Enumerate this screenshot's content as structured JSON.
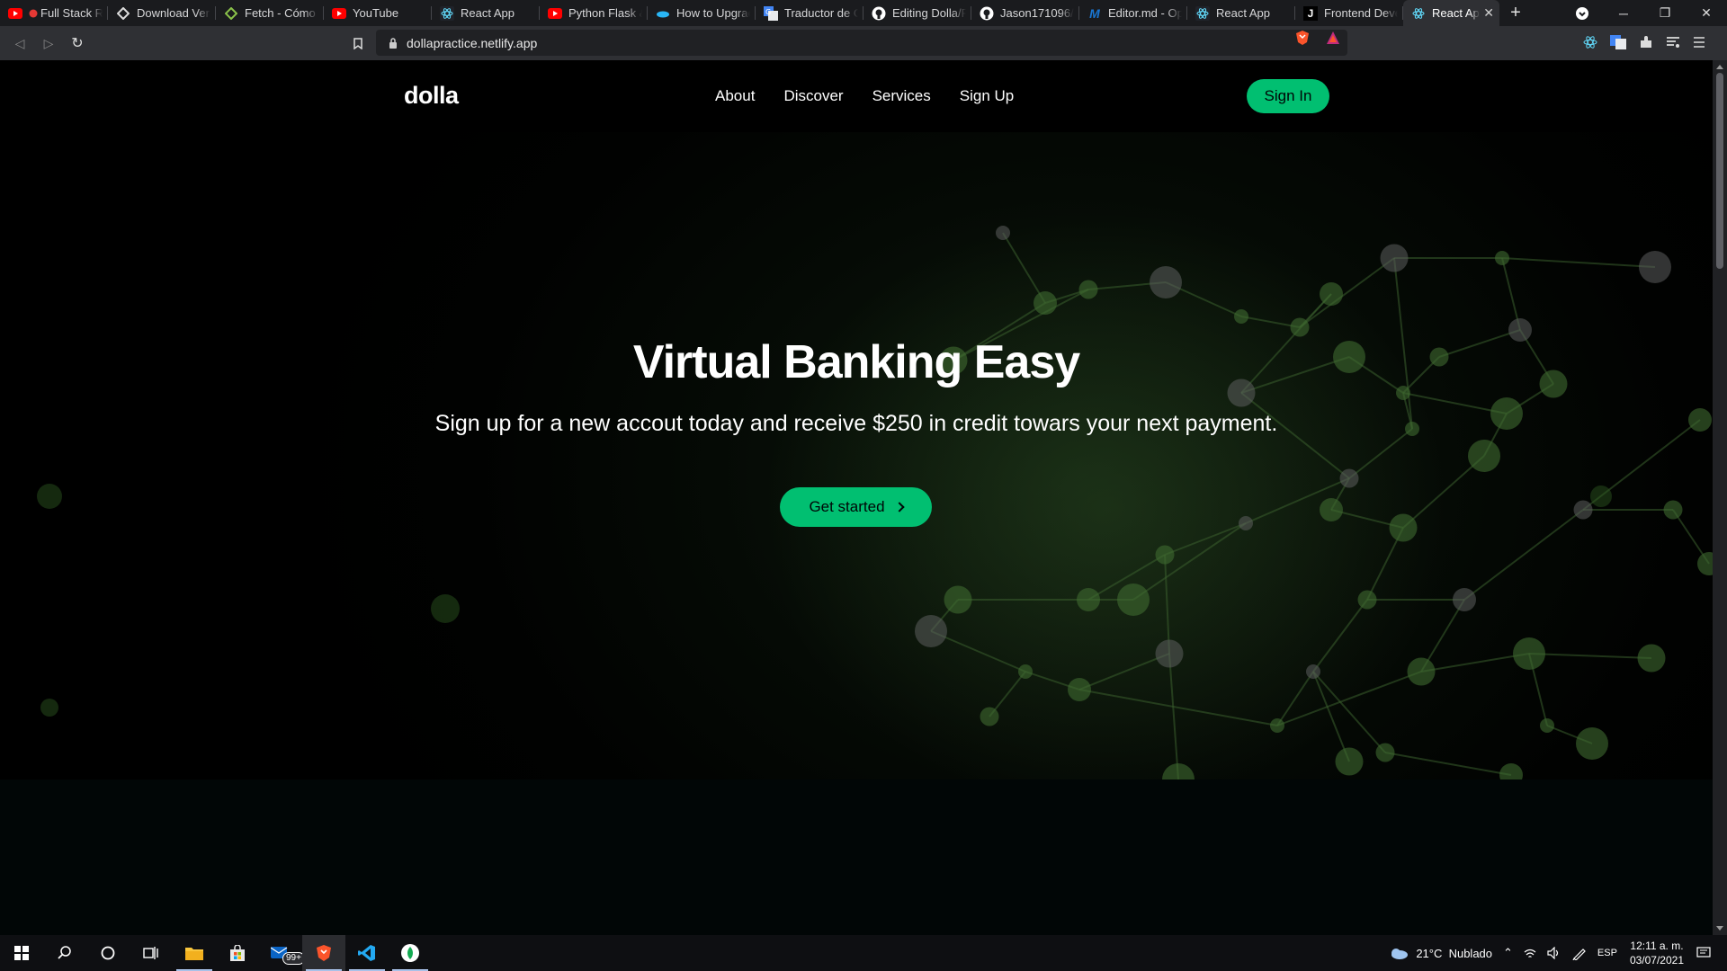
{
  "browser": {
    "tabs": [
      {
        "title": "Full Stack Re",
        "icon": "youtube-icon"
      },
      {
        "title": "Download Verif",
        "icon": "dev-icon"
      },
      {
        "title": "Fetch - Cómo c",
        "icon": "diamond-icon"
      },
      {
        "title": "YouTube",
        "icon": "youtube-icon"
      },
      {
        "title": "React App",
        "icon": "react-icon"
      },
      {
        "title": "Python Flask &",
        "icon": "youtube-icon"
      },
      {
        "title": "How to Upgrad",
        "icon": "cloud-icon"
      },
      {
        "title": "Traductor de G",
        "icon": "translate-icon"
      },
      {
        "title": "Editing Dolla/R",
        "icon": "github-icon"
      },
      {
        "title": "Jason171096/D",
        "icon": "github-icon"
      },
      {
        "title": "Editor.md - Op",
        "icon": "m-icon"
      },
      {
        "title": "React App",
        "icon": "react-icon"
      },
      {
        "title": "Frontend Deve",
        "icon": "j-icon"
      },
      {
        "title": "React App",
        "icon": "react-icon",
        "active": true
      }
    ],
    "url": "dollapractice.netlify.app"
  },
  "site": {
    "logo": "dolla",
    "nav": [
      "About",
      "Discover",
      "Services",
      "Sign Up"
    ],
    "signin": "Sign In",
    "hero_title": "Virtual Banking Easy",
    "hero_subtitle": "Sign up for a new accout today and receive $250 in credit towars your next payment.",
    "cta": "Get started",
    "accent": "#01bf71"
  },
  "taskbar": {
    "badge": "99+",
    "weather": "21°C  Nublado",
    "lang": "ESP",
    "time": "12:11 a. m.",
    "date": "03/07/2021"
  }
}
